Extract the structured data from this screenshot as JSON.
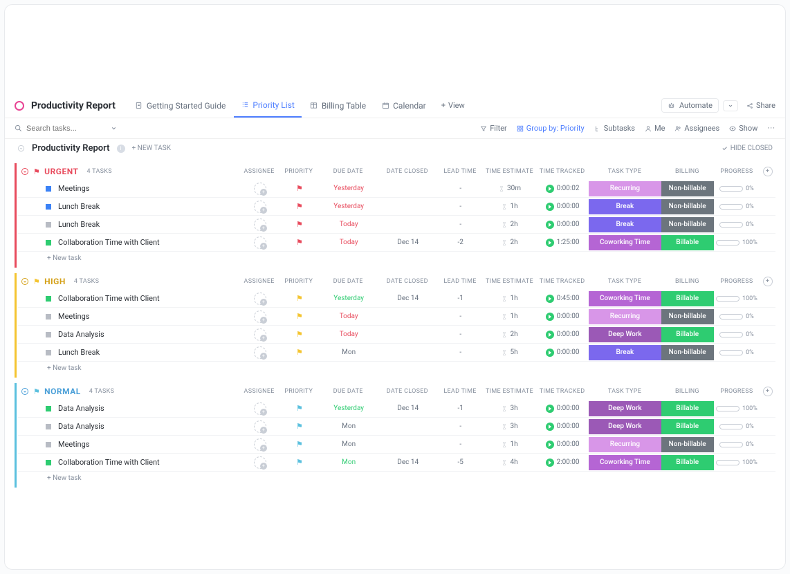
{
  "header": {
    "pageTitle": "Productivity Report",
    "tabs": [
      {
        "label": "Getting Started Guide",
        "active": false
      },
      {
        "label": "Priority List",
        "active": true
      },
      {
        "label": "Billing Table",
        "active": false
      },
      {
        "label": "Calendar",
        "active": false
      }
    ],
    "addView": "View",
    "automate": "Automate",
    "share": "Share"
  },
  "toolbar": {
    "searchPlaceholder": "Search tasks...",
    "filter": "Filter",
    "groupBy": "Group by: Priority",
    "subtasks": "Subtasks",
    "me": "Me",
    "assignees": "Assignees",
    "show": "Show"
  },
  "listHeader": {
    "title": "Productivity Report",
    "newTask": "+ NEW TASK",
    "hideClosed": "HIDE CLOSED"
  },
  "columns": {
    "assignee": "ASSIGNEE",
    "priority": "PRIORITY",
    "dueDate": "DUE DATE",
    "dateClosed": "DATE CLOSED",
    "leadTime": "LEAD TIME",
    "timeEstimate": "TIME ESTIMATE",
    "timeTracked": "TIME TRACKED",
    "taskType": "TASK TYPE",
    "billing": "BILLING",
    "progress": "PROGRESS"
  },
  "newTaskLabel": "+ New task",
  "colors": {
    "urgent": "#e84b5d",
    "high": "#f4c430",
    "normal": "#5bc0de",
    "recurring": "#d896e8",
    "break": "#7b68ee",
    "coworking": "#b565d4",
    "deepwork": "#9b59b6",
    "nonbillable": "#6c757d",
    "billable": "#2ecc71"
  },
  "groups": [
    {
      "name": "URGENT",
      "class": "urgent",
      "flagColor": "flag-red",
      "count": "4 TASKS",
      "tasks": [
        {
          "status": "sq-blue",
          "name": "Meetings",
          "due": "Yesterday",
          "dueClass": "due-red",
          "closed": "",
          "lead": "-",
          "estimate": "30m",
          "tracked": "0:00:02",
          "taskType": "Recurring",
          "taskTypeClass": "badge-recurring",
          "billing": "Non-billable",
          "billingClass": "badge-nonbill",
          "progress": 0,
          "progressLabel": "0%"
        },
        {
          "status": "sq-blue",
          "name": "Lunch Break",
          "due": "Yesterday",
          "dueClass": "due-red",
          "closed": "",
          "lead": "-",
          "estimate": "1h",
          "tracked": "0:00:00",
          "taskType": "Break",
          "taskTypeClass": "badge-break",
          "billing": "Non-billable",
          "billingClass": "badge-nonbill",
          "progress": 0,
          "progressLabel": "0%"
        },
        {
          "status": "sq-gray",
          "name": "Lunch Break",
          "due": "Today",
          "dueClass": "due-red",
          "closed": "",
          "lead": "-",
          "estimate": "2h",
          "tracked": "0:00:00",
          "taskType": "Break",
          "taskTypeClass": "badge-break",
          "billing": "Non-billable",
          "billingClass": "badge-nonbill",
          "progress": 0,
          "progressLabel": "0%"
        },
        {
          "status": "sq-green",
          "name": "Collaboration Time with Client",
          "due": "Today",
          "dueClass": "due-red",
          "closed": "Dec 14",
          "lead": "-2",
          "estimate": "2h",
          "tracked": "1:25:00",
          "taskType": "Coworking Time",
          "taskTypeClass": "badge-cowork",
          "billing": "Billable",
          "billingClass": "badge-bill",
          "progress": 100,
          "progressLabel": "100%"
        }
      ]
    },
    {
      "name": "HIGH",
      "class": "high",
      "flagColor": "flag-yellow",
      "count": "4 TASKS",
      "tasks": [
        {
          "status": "sq-green",
          "name": "Collaboration Time with Client",
          "due": "Yesterday",
          "dueClass": "due-green",
          "closed": "Dec 14",
          "lead": "-1",
          "estimate": "1h",
          "tracked": "0:45:00",
          "taskType": "Coworking Time",
          "taskTypeClass": "badge-cowork",
          "billing": "Billable",
          "billingClass": "badge-bill",
          "progress": 100,
          "progressLabel": "100%"
        },
        {
          "status": "sq-gray",
          "name": "Meetings",
          "due": "Today",
          "dueClass": "due-red",
          "closed": "",
          "lead": "-",
          "estimate": "1h",
          "tracked": "0:00:00",
          "taskType": "Recurring",
          "taskTypeClass": "badge-recurring",
          "billing": "Non-billable",
          "billingClass": "badge-nonbill",
          "progress": 0,
          "progressLabel": "0%"
        },
        {
          "status": "sq-gray",
          "name": "Data Analysis",
          "due": "Today",
          "dueClass": "due-red",
          "closed": "",
          "lead": "-",
          "estimate": "2h",
          "tracked": "0:00:00",
          "taskType": "Deep Work",
          "taskTypeClass": "badge-deepwork",
          "billing": "Billable",
          "billingClass": "badge-bill",
          "progress": 0,
          "progressLabel": "0%"
        },
        {
          "status": "sq-gray",
          "name": "Lunch Break",
          "due": "Mon",
          "dueClass": "due-gray",
          "closed": "",
          "lead": "-",
          "estimate": "5h",
          "tracked": "0:00:00",
          "taskType": "Break",
          "taskTypeClass": "badge-break",
          "billing": "Non-billable",
          "billingClass": "badge-nonbill",
          "progress": 0,
          "progressLabel": "0%"
        }
      ]
    },
    {
      "name": "NORMAL",
      "class": "normal",
      "flagColor": "flag-blue",
      "count": "4 TASKS",
      "tasks": [
        {
          "status": "sq-green",
          "name": "Data Analysis",
          "due": "Yesterday",
          "dueClass": "due-green",
          "closed": "Dec 14",
          "lead": "-1",
          "estimate": "3h",
          "tracked": "0:00:00",
          "taskType": "Deep Work",
          "taskTypeClass": "badge-deepwork",
          "billing": "Billable",
          "billingClass": "badge-bill",
          "progress": 100,
          "progressLabel": "100%"
        },
        {
          "status": "sq-gray",
          "name": "Data Analysis",
          "due": "Mon",
          "dueClass": "due-gray",
          "closed": "",
          "lead": "-",
          "estimate": "3h",
          "tracked": "0:00:00",
          "taskType": "Deep Work",
          "taskTypeClass": "badge-deepwork",
          "billing": "Billable",
          "billingClass": "badge-bill",
          "progress": 0,
          "progressLabel": "0%"
        },
        {
          "status": "sq-gray",
          "name": "Meetings",
          "due": "Mon",
          "dueClass": "due-gray",
          "closed": "",
          "lead": "-",
          "estimate": "1h",
          "tracked": "0:00:00",
          "taskType": "Recurring",
          "taskTypeClass": "badge-recurring",
          "billing": "Non-billable",
          "billingClass": "badge-nonbill",
          "progress": 0,
          "progressLabel": "0%"
        },
        {
          "status": "sq-green",
          "name": "Collaboration Time with Client",
          "due": "Mon",
          "dueClass": "due-green",
          "closed": "Dec 14",
          "lead": "-5",
          "estimate": "4h",
          "tracked": "2:00:00",
          "taskType": "Coworking Time",
          "taskTypeClass": "badge-cowork",
          "billing": "Billable",
          "billingClass": "badge-bill",
          "progress": 100,
          "progressLabel": "100%"
        }
      ]
    }
  ]
}
